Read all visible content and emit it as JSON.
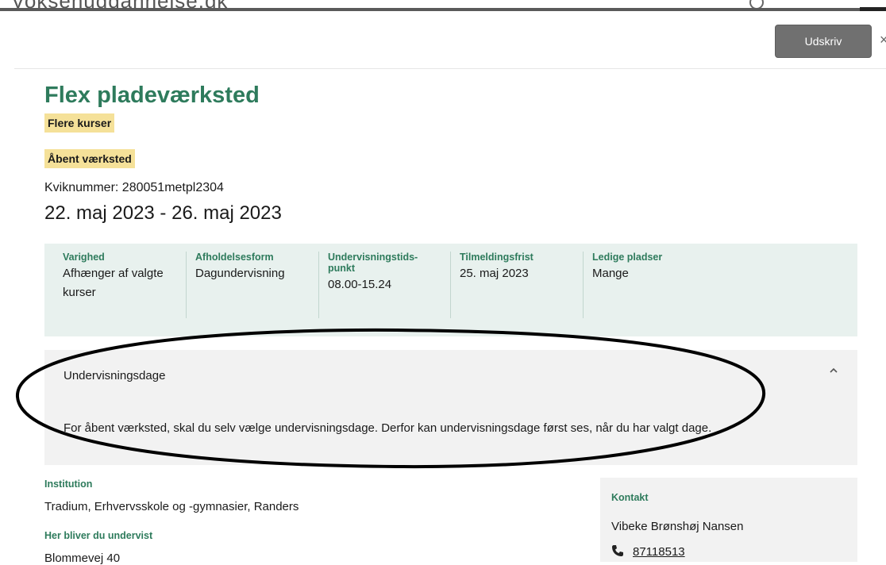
{
  "site": {
    "logo_text": "Voksenuddannelse.dk"
  },
  "toolbar": {
    "print_label": "Udskriv",
    "close_glyph": "×"
  },
  "course": {
    "title": "Flex pladeværksted",
    "tags": [
      "Flere kurser",
      "Åbent værksted"
    ],
    "kviknummer": "Kviknummer: 280051metpl2304",
    "dates": "22. maj 2023 - 26. maj 2023"
  },
  "info": [
    {
      "label": "Varighed",
      "value": "Afhænger af valgte kurser"
    },
    {
      "label": "Afholdelsesform",
      "value": "Dagundervisning"
    },
    {
      "label": "Undervisningstids-punkt",
      "value": "08.00-15.24"
    },
    {
      "label": "Tilmeldingsfrist",
      "value": "25. maj 2023"
    },
    {
      "label": "Ledige pladser",
      "value": "Mange"
    }
  ],
  "accordion": {
    "title": "Undervisningsdage",
    "expanded": true,
    "chevron_icon": "chevron-up-icon",
    "text": "For åbent værksted, skal du selv vælge undervisningsdage. Derfor kan undervisningsdage først ses, når du har valgt dage."
  },
  "institution": {
    "label": "Institution",
    "value": "Tradium, Erhvervsskole og -gymnasier, Randers"
  },
  "location": {
    "label": "Her bliver du undervist",
    "address": "Blommevej 40"
  },
  "contact": {
    "label": "Kontakt",
    "name": "Vibeke Brønshøj Nansen",
    "phone_icon": "phone-icon",
    "phone": "87118513"
  },
  "colors": {
    "brand_green": "#2e7b5c",
    "tag_yellow": "#f5e199",
    "panel_green": "#e8f1ee",
    "panel_gray": "#f2f2f2",
    "button_gray": "#707070"
  }
}
